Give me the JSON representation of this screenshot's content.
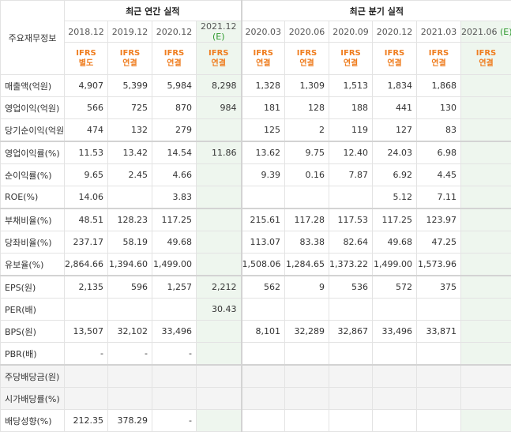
{
  "header": {
    "corner": "주요재무정보",
    "annual_group": "최근 연간 실적",
    "quarter_group": "최근 분기 실적"
  },
  "periods": [
    {
      "label": "2018.12",
      "est": "",
      "std": [
        "IFRS",
        "별도"
      ]
    },
    {
      "label": "2019.12",
      "est": "",
      "std": [
        "IFRS",
        "연결"
      ]
    },
    {
      "label": "2020.12",
      "est": "",
      "std": [
        "IFRS",
        "연결"
      ]
    },
    {
      "label": "2021.12",
      "est": "(E)",
      "std": [
        "IFRS",
        "연결"
      ]
    },
    {
      "label": "2020.03",
      "est": "",
      "std": [
        "IFRS",
        "연결"
      ]
    },
    {
      "label": "2020.06",
      "est": "",
      "std": [
        "IFRS",
        "연결"
      ]
    },
    {
      "label": "2020.09",
      "est": "",
      "std": [
        "IFRS",
        "연결"
      ]
    },
    {
      "label": "2020.12",
      "est": "",
      "std": [
        "IFRS",
        "연결"
      ]
    },
    {
      "label": "2021.03",
      "est": "",
      "std": [
        "IFRS",
        "연결"
      ]
    },
    {
      "label": "2021.06",
      "est": "(E)",
      "std": [
        "IFRS",
        "연결"
      ]
    }
  ],
  "rows": [
    {
      "label": "매출액(억원)",
      "values": [
        "4,907",
        "5,399",
        "5,984",
        "8,298",
        "1,328",
        "1,309",
        "1,513",
        "1,834",
        "1,868",
        ""
      ]
    },
    {
      "label": "영업이익(억원)",
      "values": [
        "566",
        "725",
        "870",
        "984",
        "181",
        "128",
        "188",
        "441",
        "130",
        ""
      ]
    },
    {
      "label": "당기순이익(억원)",
      "values": [
        "474",
        "132",
        "279",
        "",
        "125",
        "2",
        "119",
        "127",
        "83",
        ""
      ]
    },
    {
      "label": "영업이익률(%)",
      "values": [
        "11.53",
        "13.42",
        "14.54",
        "11.86",
        "13.62",
        "9.75",
        "12.40",
        "24.03",
        "6.98",
        ""
      ]
    },
    {
      "label": "순이익률(%)",
      "values": [
        "9.65",
        "2.45",
        "4.66",
        "",
        "9.39",
        "0.16",
        "7.87",
        "6.92",
        "4.45",
        ""
      ]
    },
    {
      "label": "ROE(%)",
      "values": [
        "14.06",
        "",
        "3.83",
        "",
        "",
        "",
        "",
        "5.12",
        "7.11",
        ""
      ]
    },
    {
      "label": "부채비율(%)",
      "values": [
        "48.51",
        "128.23",
        "117.25",
        "",
        "215.61",
        "117.28",
        "117.53",
        "117.25",
        "123.97",
        ""
      ]
    },
    {
      "label": "당좌비율(%)",
      "values": [
        "237.17",
        "58.19",
        "49.68",
        "",
        "113.07",
        "83.38",
        "82.64",
        "49.68",
        "47.25",
        ""
      ]
    },
    {
      "label": "유보율(%)",
      "values": [
        "2,864.66",
        "1,394.60",
        "1,499.00",
        "",
        "1,508.06",
        "1,284.65",
        "1,373.22",
        "1,499.00",
        "1,573.96",
        ""
      ]
    },
    {
      "label": "EPS(원)",
      "values": [
        "2,135",
        "596",
        "1,257",
        "2,212",
        "562",
        "9",
        "536",
        "572",
        "375",
        ""
      ]
    },
    {
      "label": "PER(배)",
      "values": [
        "",
        "",
        "",
        "30.43",
        "",
        "",
        "",
        "",
        "",
        ""
      ]
    },
    {
      "label": "BPS(원)",
      "values": [
        "13,507",
        "32,102",
        "33,496",
        "",
        "8,101",
        "32,289",
        "32,867",
        "33,496",
        "33,871",
        ""
      ]
    },
    {
      "label": "PBR(배)",
      "values": [
        "-",
        "-",
        "-",
        "",
        "",
        "",
        "",
        "",
        "",
        ""
      ]
    },
    {
      "label": "주당배당금(원)",
      "values": [
        "",
        "",
        "",
        "",
        "",
        "",
        "",
        "",
        "",
        ""
      ]
    },
    {
      "label": "시가배당률(%)",
      "values": [
        "",
        "",
        "",
        "",
        "",
        "",
        "",
        "",
        "",
        ""
      ]
    },
    {
      "label": "배당성향(%)",
      "values": [
        "212.35",
        "378.29",
        "-",
        "",
        "",
        "",
        "",
        "",
        "",
        ""
      ]
    }
  ],
  "colors": {
    "standard": "#ef7d1f",
    "estimate": "#2d9a2d",
    "estimate_bg": "#eef6ee"
  }
}
